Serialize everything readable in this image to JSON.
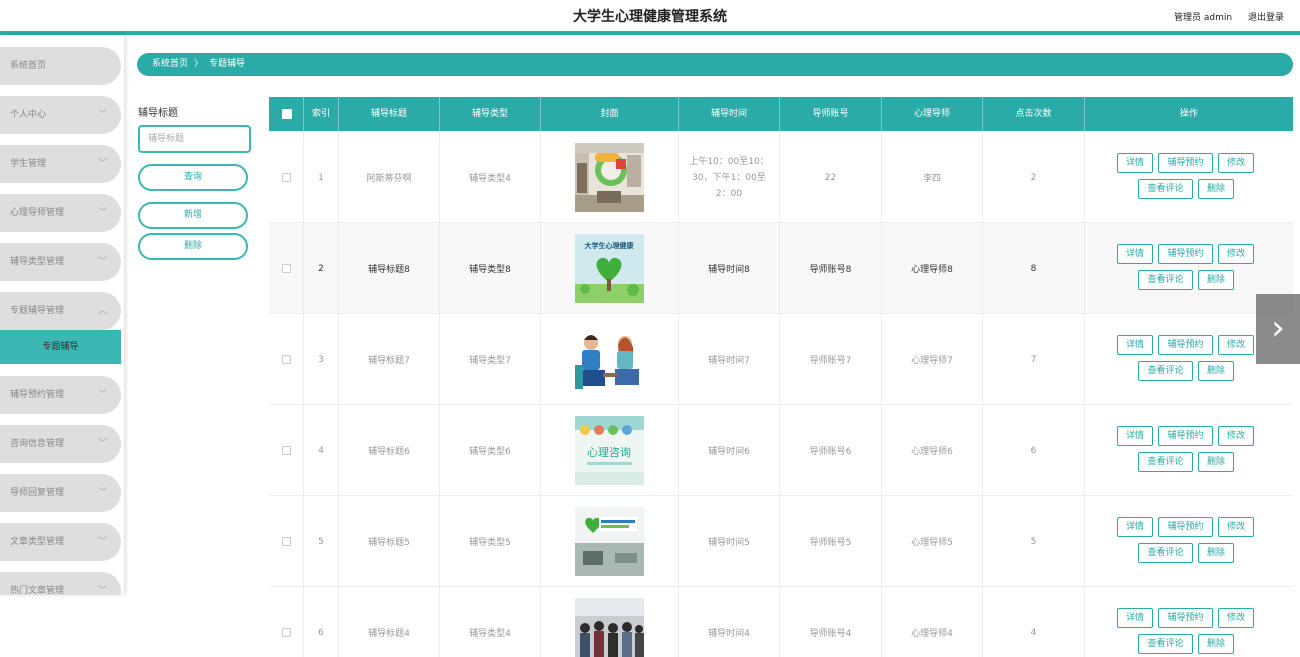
{
  "header": {
    "title": "大学生心理健康管理系统",
    "admin": "管理员 admin",
    "logout": "退出登录"
  },
  "sidebar": {
    "items": [
      {
        "label": "系统首页",
        "chev": ""
      },
      {
        "label": "个人中心",
        "chev": "﹀"
      },
      {
        "label": "学生管理",
        "chev": "﹀"
      },
      {
        "label": "心理导师管理",
        "chev": "﹀"
      },
      {
        "label": "辅导类型管理",
        "chev": "﹀"
      },
      {
        "label": "专题辅导管理",
        "chev": "︿"
      },
      {
        "label": "辅导预约管理",
        "chev": "﹀"
      },
      {
        "label": "咨询信息管理",
        "chev": "﹀"
      },
      {
        "label": "导师回复管理",
        "chev": "﹀"
      },
      {
        "label": "文章类型管理",
        "chev": "﹀"
      },
      {
        "label": "热门文章管理",
        "chev": "﹀"
      }
    ],
    "sub_item": "专题辅导"
  },
  "breadcrumb": {
    "home": "系统首页",
    "sep": "〉",
    "current": "专题辅导"
  },
  "filter": {
    "label": "辅导标题",
    "placeholder": "辅导标题",
    "search": "查询",
    "add": "新增",
    "delete": "删除"
  },
  "table": {
    "headers": [
      "索引",
      "辅导标题",
      "辅导类型",
      "封面",
      "辅导时间",
      "导师账号",
      "心理导师",
      "点击次数",
      "操作"
    ],
    "actions": {
      "detail": "详情",
      "appoint": "辅导预约",
      "edit": "修改",
      "comments": "查看评论",
      "delete": "删除"
    },
    "rows": [
      {
        "index": "1",
        "title": "阿斯蒂芬啊",
        "type": "辅导类型4",
        "cover": "cover-classroom-photo",
        "time": "上午10：00至10：30，下午1：00至2：00",
        "account": "22",
        "mentor": "李四",
        "clicks": "2"
      },
      {
        "index": "2",
        "title": "辅导标题8",
        "type": "辅导类型8",
        "cover": "cover-poster-heart-tree",
        "time": "辅导时间8",
        "account": "导师账号8",
        "mentor": "心理导师8",
        "clicks": "8"
      },
      {
        "index": "3",
        "title": "辅导标题7",
        "type": "辅导类型7",
        "cover": "cover-counseling-illustration",
        "time": "辅导时间7",
        "account": "导师账号7",
        "mentor": "心理导师7",
        "clicks": "7"
      },
      {
        "index": "4",
        "title": "辅导标题6",
        "type": "辅导类型6",
        "cover": "cover-consult-poster",
        "time": "辅导时间6",
        "account": "导师账号6",
        "mentor": "心理导师6",
        "clicks": "6"
      },
      {
        "index": "5",
        "title": "辅导标题5",
        "type": "辅导类型5",
        "cover": "cover-room-photo",
        "time": "辅导时间5",
        "account": "导师账号5",
        "mentor": "心理导师5",
        "clicks": "5"
      },
      {
        "index": "6",
        "title": "辅导标题4",
        "type": "辅导类型4",
        "cover": "cover-group-photo",
        "time": "辅导时间4",
        "account": "导师账号4",
        "mentor": "心理导师4",
        "clicks": "4"
      }
    ]
  },
  "colors": {
    "accent": "#2aaba7",
    "sidebar_item": "#dedede",
    "sidebar_active": "#3ab7b3"
  },
  "icons": {
    "next": "chevron-right-icon",
    "expand": "chevron-down-icon",
    "collapse": "chevron-up-icon"
  },
  "arrow": "›"
}
